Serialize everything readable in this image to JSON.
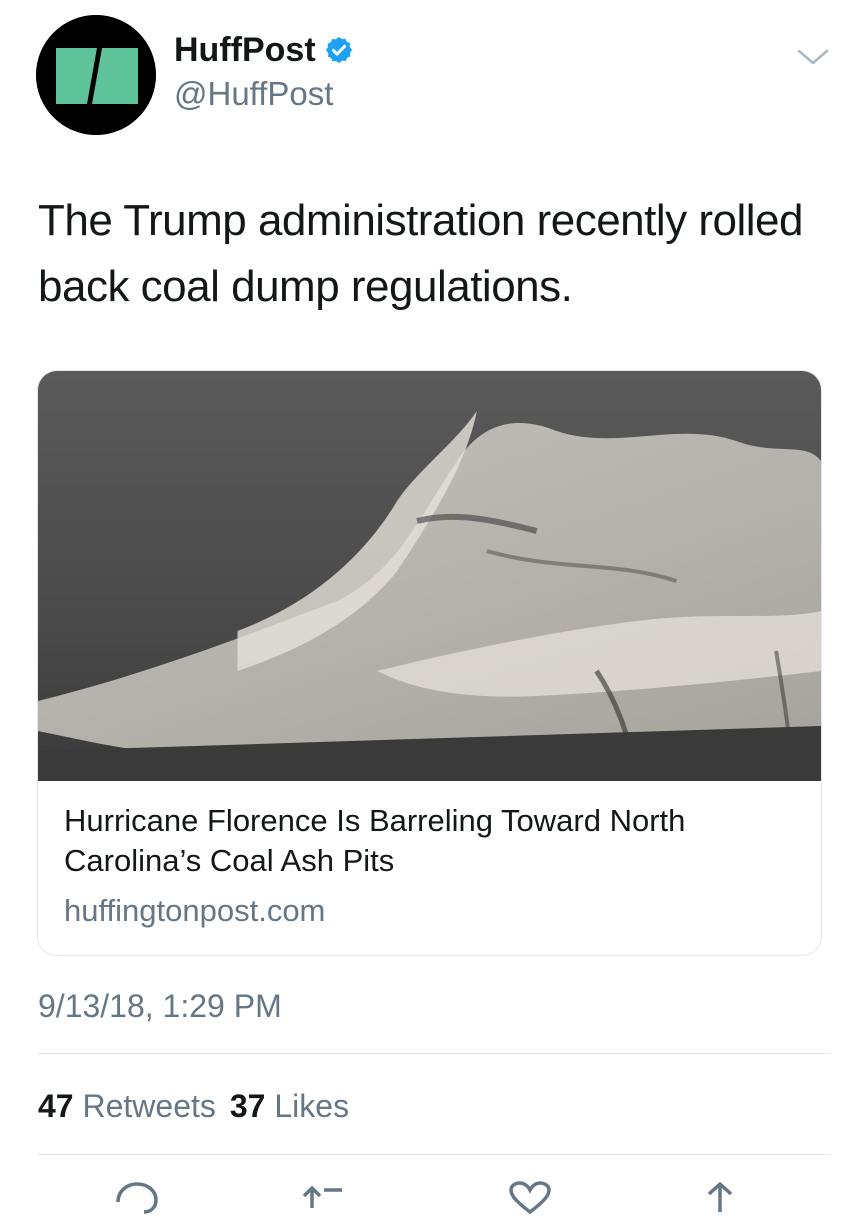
{
  "author": {
    "display_name": "HuffPost",
    "handle": "@HuffPost",
    "verified": true,
    "avatar_icon": "huffpost-logo"
  },
  "tweet": {
    "text": "The Trump administration recently rolled back coal dump regulations."
  },
  "link_card": {
    "image_icon": "coal-ash-photo",
    "title": "Hurricane Florence Is Barreling Toward North Carolina’s Coal Ash Pits",
    "domain": "huffingtonpost.com"
  },
  "timestamp": "9/13/18, 1:29 PM",
  "stats": {
    "retweets_count": "47",
    "retweets_label": "Retweets",
    "likes_count": "37",
    "likes_label": "Likes"
  },
  "actions": [
    "reply-icon",
    "retweet-icon",
    "like-icon",
    "share-icon"
  ],
  "colors": {
    "logo_green": "#5ec29b",
    "verified_blue": "#1da1f2",
    "secondary_text": "#657786"
  }
}
